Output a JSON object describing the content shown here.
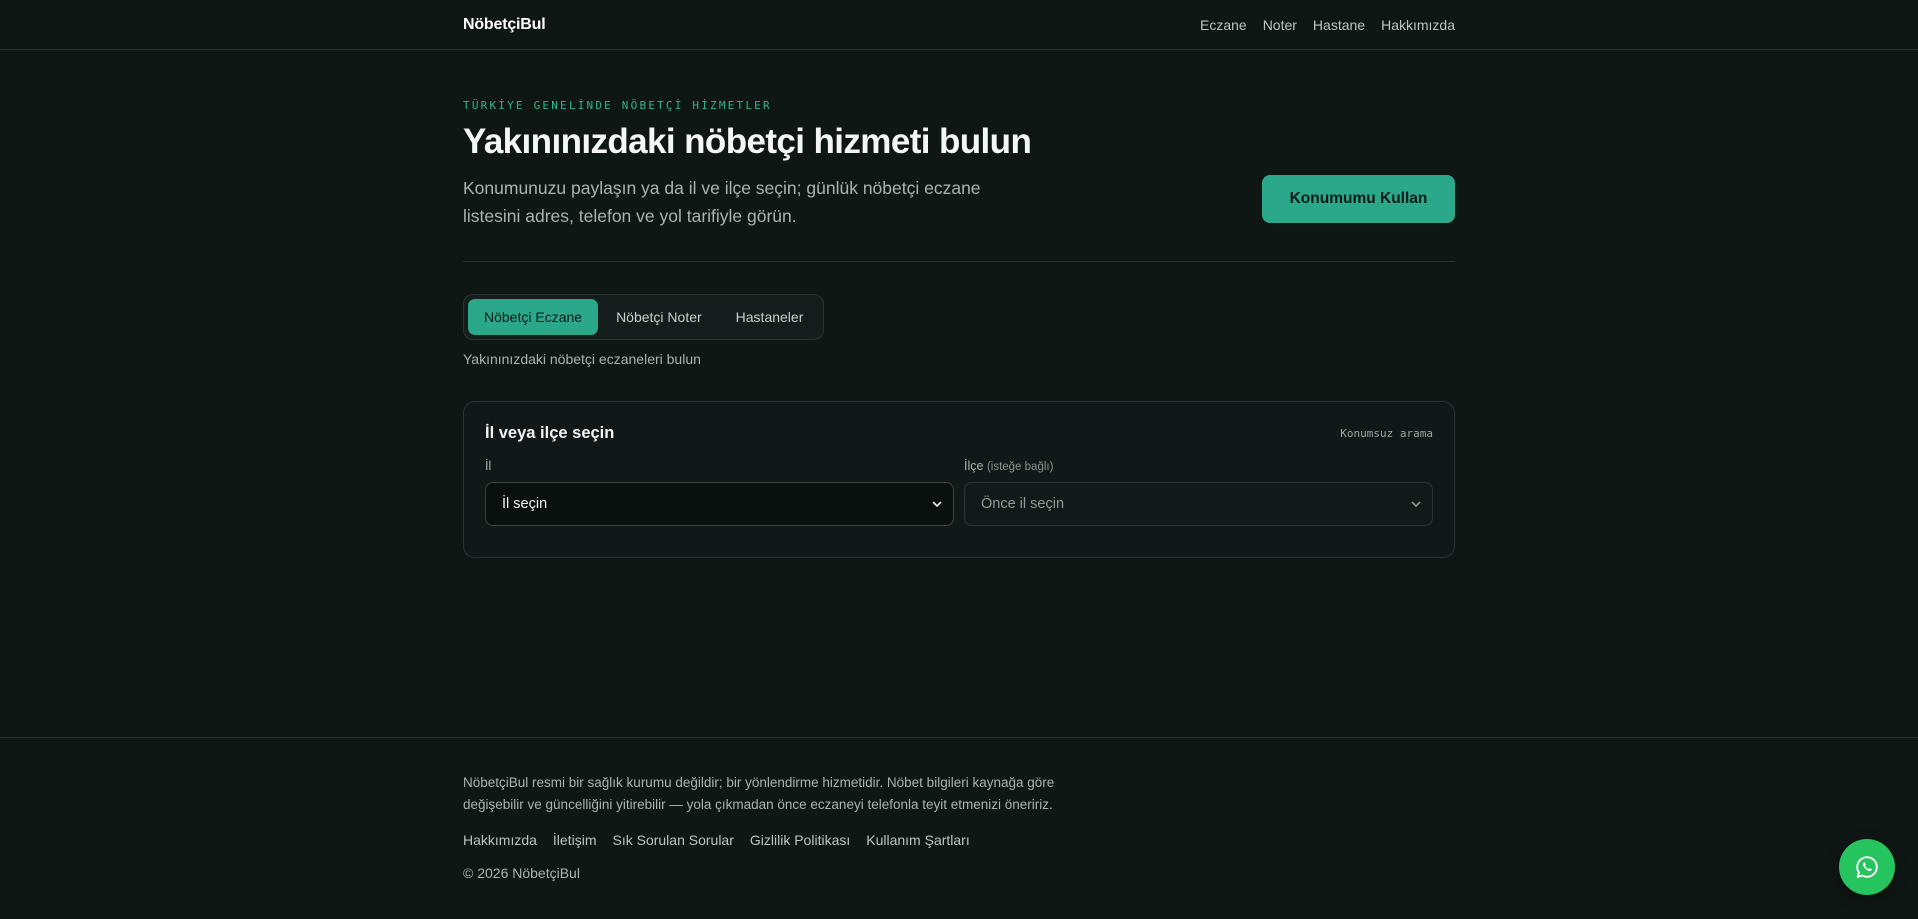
{
  "header": {
    "brand": "NöbetçiBul",
    "nav": [
      "Eczane",
      "Noter",
      "Hastane",
      "Hakkımızda"
    ]
  },
  "hero": {
    "eyebrow": "TÜRKİYE GENELİNDE NÖBETÇİ HİZMETLER",
    "title": "Yakınınızdaki nöbetçi hizmeti bulun",
    "description": "Konumunuzu paylaşın ya da il ve ilçe seçin; günlük nöbetçi eczane listesini adres, telefon ve yol tarifiyle görün.",
    "cta_label": "Konumumu Kullan"
  },
  "tabs": {
    "items": [
      "Nöbetçi Eczane",
      "Nöbetçi Noter",
      "Hastaneler"
    ],
    "active_index": 0,
    "hint": "Yakınınızdaki nöbetçi eczaneleri bulun"
  },
  "location_card": {
    "title": "İl veya ilçe seçin",
    "tag": "Konumsuz arama",
    "province": {
      "label": "İl",
      "selected": "İl seçin"
    },
    "district": {
      "label": "İlçe",
      "label_note": "(isteğe bağlı)",
      "selected": "Önce il seçin"
    }
  },
  "footer": {
    "disclaimer": "NöbetçiBul resmi bir sağlık kurumu değildir; bir yönlendirme hizmetidir. Nöbet bilgileri kaynağa göre değişebilir ve güncelliğini yitirebilir — yola çıkmadan önce eczaneyi telefonla teyit etmenizi öneririz.",
    "links": [
      "Hakkımızda",
      "İletişim",
      "Sık Sorulan Sorular",
      "Gizlilik Politikası",
      "Kullanım Şartları"
    ],
    "copyright": "© 2026 NöbetçiBul"
  },
  "floating": {
    "icon": "whatsapp-icon"
  },
  "colors": {
    "background": "#0f1715",
    "accent": "#2aa889",
    "whatsapp": "#25c45f"
  }
}
